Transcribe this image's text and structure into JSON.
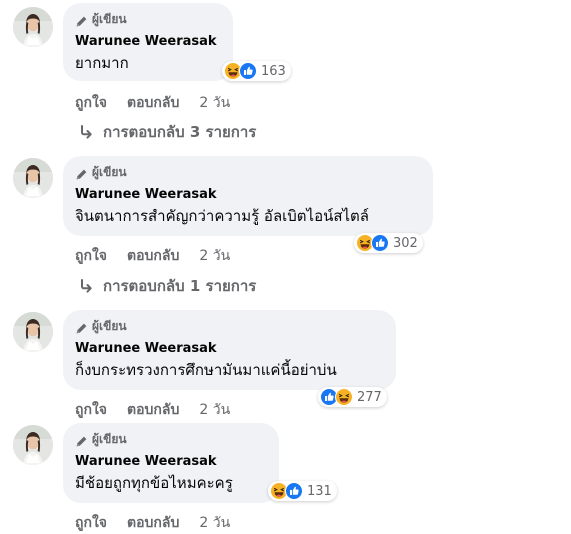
{
  "comments": [
    {
      "badge": "ผู้เขียน",
      "author": "Warunee Weerasak",
      "text": "ยากมาก",
      "reactions": [
        "haha",
        "like"
      ],
      "reaction_count": "163",
      "like_label": "ถูกใจ",
      "reply_label": "ตอบกลับ",
      "time": "2 วัน",
      "replies_label": "การตอบกลับ 3 รายการ"
    },
    {
      "badge": "ผู้เขียน",
      "author": "Warunee Weerasak",
      "text": "จินตนาการสำคัญกว่าความรู้ อัลเบิตไอน์สไตล์",
      "reactions": [
        "haha",
        "like"
      ],
      "reaction_count": "302",
      "like_label": "ถูกใจ",
      "reply_label": "ตอบกลับ",
      "time": "2 วัน",
      "replies_label": "การตอบกลับ 1 รายการ"
    },
    {
      "badge": "ผู้เขียน",
      "author": "Warunee Weerasak",
      "text": "ก็งบกระทรวงการศึกษามันมาแค่นี้อย่าบ่น",
      "reactions": [
        "like",
        "haha"
      ],
      "reaction_count": "277",
      "like_label": "ถูกใจ",
      "reply_label": "ตอบกลับ",
      "time": "2 วัน"
    },
    {
      "badge": "ผู้เขียน",
      "author": "Warunee Weerasak",
      "text": "มีช้อยถูกทุกข้อไหมคะครู",
      "reactions": [
        "haha",
        "like"
      ],
      "reaction_count": "131",
      "like_label": "ถูกใจ",
      "reply_label": "ตอบกลับ",
      "time": "2 วัน"
    }
  ],
  "colors": {
    "bubble": "#f0f2f5",
    "secondary_text": "#65676b",
    "like_blue": "#1877f2",
    "haha_yellow": "#f7b125"
  },
  "icons": {
    "badge": "pencil-icon",
    "replies": "reply-arrow-icon",
    "reactions": [
      "like-reaction-icon",
      "haha-reaction-icon"
    ]
  }
}
